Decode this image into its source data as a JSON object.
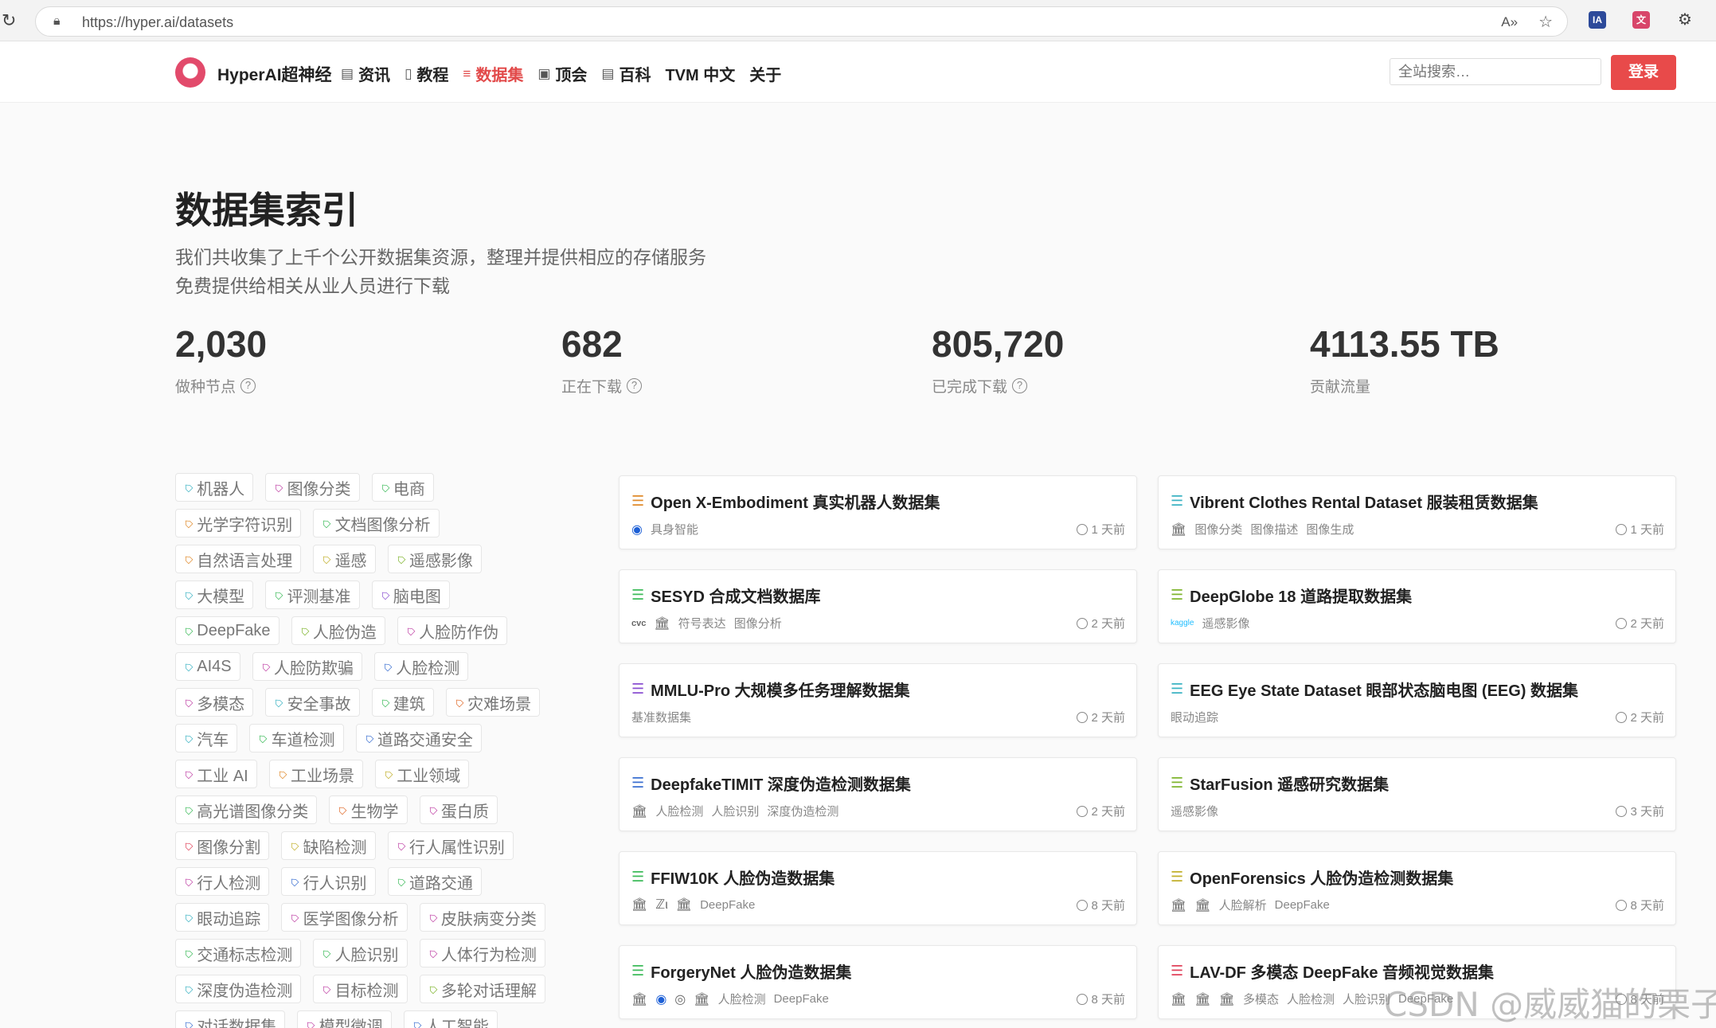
{
  "browser": {
    "url": "https://hyper.ai/datasets"
  },
  "header": {
    "brand": "HyperAI超神经",
    "nav": [
      {
        "label": "资讯",
        "icon": "document-icon",
        "active": false
      },
      {
        "label": "教程",
        "icon": "book-icon",
        "active": false
      },
      {
        "label": "数据集",
        "icon": "database-icon",
        "active": true
      },
      {
        "label": "顶会",
        "icon": "calendar-icon",
        "active": false
      },
      {
        "label": "百科",
        "icon": "encyclopedia-icon",
        "active": false
      },
      {
        "label": "TVM 中文",
        "icon": "",
        "active": false
      },
      {
        "label": "关于",
        "icon": "",
        "active": false
      }
    ],
    "search_placeholder": "全站搜索…",
    "login_label": "登录"
  },
  "hero": {
    "title": "数据集索引",
    "desc_line1": "我们共收集了上千个公开数据集资源，整理并提供相应的存储服务",
    "desc_line2": "免费提供给相关从业人员进行下载"
  },
  "stats": [
    {
      "value": "2,030",
      "label": "做种节点",
      "help": true
    },
    {
      "value": "682",
      "label": "正在下载",
      "help": true
    },
    {
      "value": "805,720",
      "label": "已完成下载",
      "help": true
    },
    {
      "value": "4113.55 TB",
      "label": "贡献流量",
      "help": false
    }
  ],
  "tag_rows": [
    [
      {
        "label": "机器人",
        "color": "#3bb3c3"
      },
      {
        "label": "图像分类",
        "color": "#c043a6"
      },
      {
        "label": "电商",
        "color": "#3dbb5a"
      }
    ],
    [
      {
        "label": "光学字符识别",
        "color": "#e08a2a"
      },
      {
        "label": "文档图像分析",
        "color": "#3dbb5a"
      }
    ],
    [
      {
        "label": "自然语言处理",
        "color": "#e08a2a"
      },
      {
        "label": "遥感",
        "color": "#c2b02c"
      },
      {
        "label": "遥感影像",
        "color": "#7fb52e"
      }
    ],
    [
      {
        "label": "大模型",
        "color": "#3bb3c3"
      },
      {
        "label": "评测基准",
        "color": "#3dbb5a"
      },
      {
        "label": "脑电图",
        "color": "#8a4fd1"
      }
    ],
    [
      {
        "label": "DeepFake",
        "color": "#3dbb5a"
      },
      {
        "label": "人脸伪造",
        "color": "#7fb52e"
      },
      {
        "label": "人脸防作伪",
        "color": "#c043a6"
      }
    ],
    [
      {
        "label": "AI4S",
        "color": "#3bb3c3"
      },
      {
        "label": "人脸防欺骗",
        "color": "#c043a6"
      },
      {
        "label": "人脸检测",
        "color": "#3a6fd1"
      }
    ],
    [
      {
        "label": "多模态",
        "color": "#c043a6"
      },
      {
        "label": "安全事故",
        "color": "#3bb3c3"
      },
      {
        "label": "建筑",
        "color": "#3dbb5a"
      },
      {
        "label": "灾难场景",
        "color": "#e06a2a"
      }
    ],
    [
      {
        "label": "汽车",
        "color": "#3bb3c3"
      },
      {
        "label": "车道检测",
        "color": "#3dbb5a"
      },
      {
        "label": "道路交通安全",
        "color": "#3a6fd1"
      }
    ],
    [
      {
        "label": "工业 AI",
        "color": "#c043a6"
      },
      {
        "label": "工业场景",
        "color": "#e08a2a"
      },
      {
        "label": "工业领域",
        "color": "#c2b02c"
      }
    ],
    [
      {
        "label": "高光谱图像分类",
        "color": "#3dbb5a"
      },
      {
        "label": "生物学",
        "color": "#e06a2a"
      },
      {
        "label": "蛋白质",
        "color": "#c043a6"
      }
    ],
    [
      {
        "label": "图像分割",
        "color": "#e0425a"
      },
      {
        "label": "缺陷检测",
        "color": "#c2b02c"
      },
      {
        "label": "行人属性识别",
        "color": "#c043a6"
      }
    ],
    [
      {
        "label": "行人检测",
        "color": "#c043a6"
      },
      {
        "label": "行人识别",
        "color": "#3a6fd1"
      },
      {
        "label": "道路交通",
        "color": "#3dbb5a"
      }
    ],
    [
      {
        "label": "眼动追踪",
        "color": "#3bb3c3"
      },
      {
        "label": "医学图像分析",
        "color": "#c043a6"
      },
      {
        "label": "皮肤病变分类",
        "color": "#c043a6"
      }
    ],
    [
      {
        "label": "交通标志检测",
        "color": "#3dbb5a"
      },
      {
        "label": "人脸识别",
        "color": "#3dbb5a"
      },
      {
        "label": "人体行为检测",
        "color": "#c043a6"
      }
    ],
    [
      {
        "label": "深度伪造检测",
        "color": "#3bb3c3"
      },
      {
        "label": "目标检测",
        "color": "#c043a6"
      },
      {
        "label": "多轮对话理解",
        "color": "#7fb52e"
      }
    ],
    [
      {
        "label": "对话数据集",
        "color": "#3a6fd1"
      },
      {
        "label": "模型微调",
        "color": "#c043a6"
      },
      {
        "label": "人工智能",
        "color": "#3a6fd1"
      }
    ]
  ],
  "datasets": [
    {
      "title": "Open X-Embodiment 真实机器人数据集",
      "meta": [
        "具身智能"
      ],
      "time": "1 天前",
      "color": "#e08a2a",
      "org_icons": [
        "logo-icon"
      ]
    },
    {
      "title": "Vibrent Clothes Rental Dataset 服装租赁数据集",
      "meta": [
        "图像分类",
        "图像描述",
        "图像生成"
      ],
      "time": "1 天前",
      "color": "#3bb3c3",
      "org_icons": [
        "institution-icon"
      ]
    },
    {
      "title": "SESYD 合成文档数据库",
      "meta": [
        "符号表达",
        "图像分析"
      ],
      "time": "2 天前",
      "color": "#3dbb5a",
      "org_icons": [
        "cvc-logo-icon",
        "institution-icon"
      ]
    },
    {
      "title": "DeepGlobe 18 道路提取数据集",
      "meta": [
        "遥感影像"
      ],
      "time": "2 天前",
      "color": "#7fb52e",
      "org_icons": [
        "kaggle-logo-icon"
      ]
    },
    {
      "title": "MMLU-Pro 大规模多任务理解数据集",
      "meta": [
        "基准数据集"
      ],
      "time": "2 天前",
      "color": "#8a4fd1",
      "org_icons": []
    },
    {
      "title": "EEG Eye State Dataset 眼部状态脑电图 (EEG) 数据集",
      "meta": [
        "眼动追踪"
      ],
      "time": "2 天前",
      "color": "#3bb3c3",
      "org_icons": []
    },
    {
      "title": "DeepfakeTIMIT 深度伪造检测数据集",
      "meta": [
        "人脸检测",
        "人脸识别",
        "深度伪造检测"
      ],
      "time": "2 天前",
      "color": "#3a6fd1",
      "org_icons": [
        "institution-icon"
      ]
    },
    {
      "title": "StarFusion 遥感研究数据集",
      "meta": [
        "遥感影像"
      ],
      "time": "3 天前",
      "color": "#7fb52e",
      "org_icons": []
    },
    {
      "title": "FFIW10K 人脸伪造数据集",
      "meta": [
        "DeepFake"
      ],
      "time": "8 天前",
      "color": "#3dbb5a",
      "org_icons": [
        "institution-icon",
        "zi-logo-icon",
        "institution-icon"
      ]
    },
    {
      "title": "OpenForensics 人脸伪造检测数据集",
      "meta": [
        "人脸解析",
        "DeepFake"
      ],
      "time": "8 天前",
      "color": "#c2b02c",
      "org_icons": [
        "institution-icon",
        "institution-icon"
      ]
    },
    {
      "title": "ForgeryNet 人脸伪造数据集",
      "meta": [
        "人脸检测",
        "DeepFake"
      ],
      "time": "8 天前",
      "color": "#3dbb5a",
      "org_icons": [
        "institution-icon",
        "logo-icon",
        "seal-icon",
        "institution-icon"
      ]
    },
    {
      "title": "LAV-DF 多模态 DeepFake 音频视觉数据集",
      "meta": [
        "多模态",
        "人脸检测",
        "人脸识别",
        "DeepFake"
      ],
      "time": "8 天前",
      "color": "#e0425a",
      "org_icons": [
        "institution-icon",
        "institution-icon",
        "institution-icon"
      ]
    }
  ],
  "watermark": "CSDN @威威猫的栗子"
}
